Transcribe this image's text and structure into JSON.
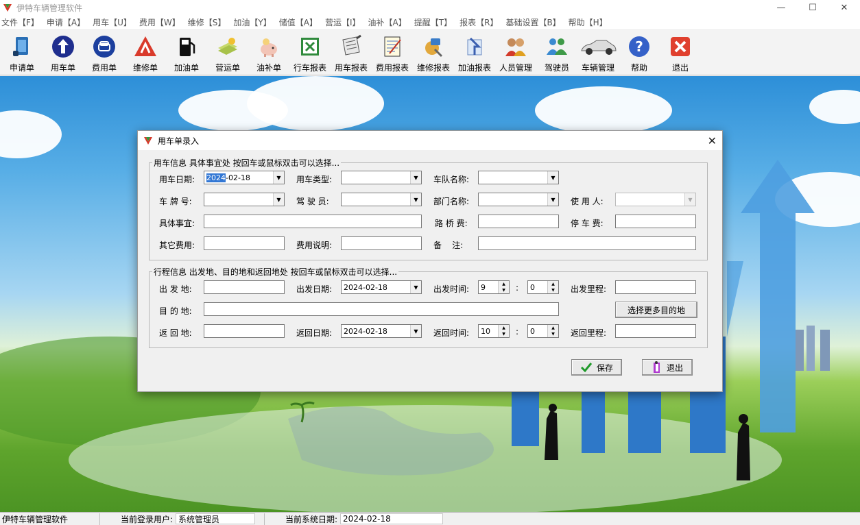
{
  "window": {
    "title": "伊特车辆管理软件",
    "minimize": "—",
    "maximize": "☐",
    "close": "✕"
  },
  "menu": [
    {
      "label": "文件【F】"
    },
    {
      "label": "申请【A】"
    },
    {
      "label": "用车【U】"
    },
    {
      "label": "费用【W】"
    },
    {
      "label": "维修【S】"
    },
    {
      "label": "加油【Y】"
    },
    {
      "label": "储值【A】"
    },
    {
      "label": "营运【I】"
    },
    {
      "label": "油补【A】"
    },
    {
      "label": "提醒【T】"
    },
    {
      "label": "报表【R】"
    },
    {
      "label": "基础设置【B】"
    },
    {
      "label": "帮助【H】"
    }
  ],
  "toolbar": [
    {
      "label": "申请单",
      "icon": "request-form-icon"
    },
    {
      "label": "用车单",
      "icon": "up-arrow-icon"
    },
    {
      "label": "费用单",
      "icon": "car-badge-icon"
    },
    {
      "label": "维修单",
      "icon": "warning-triangle-icon"
    },
    {
      "label": "加油单",
      "icon": "fuel-pump-icon"
    },
    {
      "label": "营运单",
      "icon": "money-stack-icon"
    },
    {
      "label": "油补单",
      "icon": "piggy-bank-icon"
    },
    {
      "label": "行车报表",
      "icon": "excel-icon"
    },
    {
      "label": "用车报表",
      "icon": "scroll-pen-icon"
    },
    {
      "label": "费用报表",
      "icon": "notepad-icon"
    },
    {
      "label": "维修报表",
      "icon": "repair-icon"
    },
    {
      "label": "加油报表",
      "icon": "fuel-report-icon"
    },
    {
      "label": "人员管理",
      "icon": "people-icon"
    },
    {
      "label": "驾驶员",
      "icon": "drivers-icon"
    },
    {
      "label": "车辆管理",
      "icon": "car-icon"
    },
    {
      "label": "帮助",
      "icon": "help-icon"
    },
    {
      "label": "退出",
      "icon": "exit-icon"
    }
  ],
  "dialog": {
    "title": "用车单录入",
    "close": "✕",
    "group1": {
      "legend": "用车信息 具体事宜处 按回车或鼠标双击可以选择...",
      "use_date_label": "用车日期:",
      "use_date_sel": "2024",
      "use_date_rest": "-02-18",
      "use_type_label": "用车类型:",
      "fleet_label": "车队名称:",
      "plate_label": "车 牌 号:",
      "driver_label": "驾 驶 员:",
      "dept_label": "部门名称:",
      "user_label": "使 用 人:",
      "matter_label": "具体事宜:",
      "toll_label": "路 桥 费:",
      "parking_label": "停 车 费:",
      "other_label": "其它费用:",
      "fee_note_label": "费用说明:",
      "remark_label": "备    注:"
    },
    "group2": {
      "legend": "行程信息 出发地、目的地和返回地处 按回车或鼠标双击可以选择...",
      "depart_place_label": "出 发 地:",
      "depart_date_label": "出发日期:",
      "depart_date": "2024-02-18",
      "depart_time_label": "出发时间:",
      "depart_hour": "9",
      "depart_min": "0",
      "depart_mileage_label": "出发里程:",
      "dest_label": "目 的 地:",
      "more_dest_button": "选择更多目的地",
      "return_place_label": "返 回 地:",
      "return_date_label": "返回日期:",
      "return_date": "2024-02-18",
      "return_time_label": "返回时间:",
      "return_hour": "10",
      "return_min": "0",
      "return_mileage_label": "返回里程:",
      "colon": ":"
    },
    "save_button": "保存",
    "exit_button": "退出"
  },
  "status": {
    "app": "伊特车辆管理软件",
    "user_label": "当前登录用户:",
    "user": "系统管理员",
    "date_label": "当前系统日期:",
    "date": "2024-02-18"
  }
}
